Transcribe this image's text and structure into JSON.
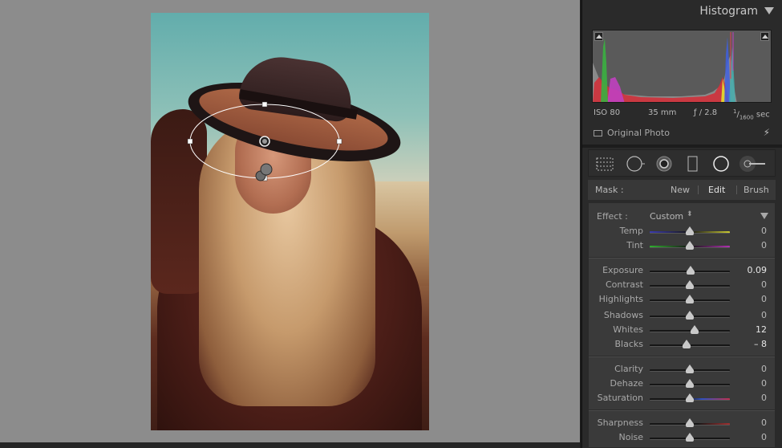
{
  "panel": {
    "title": "Histogram"
  },
  "exif": {
    "iso": "ISO 80",
    "focal": "35 mm",
    "aperture": "ƒ / 2.8",
    "shutter_num": "1",
    "shutter_den": "1600",
    "shutter_unit": "sec"
  },
  "original_photo_label": "Original Photo",
  "mask": {
    "label": "Mask :",
    "new": "New",
    "edit": "Edit",
    "brush": "Brush"
  },
  "effect": {
    "label": "Effect :",
    "value": "Custom"
  },
  "sliders": {
    "temp": {
      "label": "Temp",
      "value": "0",
      "pos": 0.5
    },
    "tint": {
      "label": "Tint",
      "value": "0",
      "pos": 0.5
    },
    "exposure": {
      "label": "Exposure",
      "value": "0.09",
      "pos": 0.51
    },
    "contrast": {
      "label": "Contrast",
      "value": "0",
      "pos": 0.5
    },
    "highlights": {
      "label": "Highlights",
      "value": "0",
      "pos": 0.5
    },
    "shadows": {
      "label": "Shadows",
      "value": "0",
      "pos": 0.5
    },
    "whites": {
      "label": "Whites",
      "value": "12",
      "pos": 0.56
    },
    "blacks": {
      "label": "Blacks",
      "value": "– 8",
      "pos": 0.46
    },
    "clarity": {
      "label": "Clarity",
      "value": "0",
      "pos": 0.5
    },
    "dehaze": {
      "label": "Dehaze",
      "value": "0",
      "pos": 0.5
    },
    "saturation": {
      "label": "Saturation",
      "value": "0",
      "pos": 0.5
    },
    "sharpness": {
      "label": "Sharpness",
      "value": "0",
      "pos": 0.5
    },
    "noise": {
      "label": "Noise",
      "value": "0",
      "pos": 0.5
    }
  },
  "icons": [
    "crop-overlay-icon",
    "spot-removal-icon",
    "red-eye-icon",
    "graduated-filter-icon",
    "radial-filter-icon",
    "adjustment-brush-icon"
  ],
  "colors": {
    "panel_bg": "#2a2a2a",
    "canvas_bg": "#8c8c8c",
    "active_text": "#e6e6e6"
  }
}
